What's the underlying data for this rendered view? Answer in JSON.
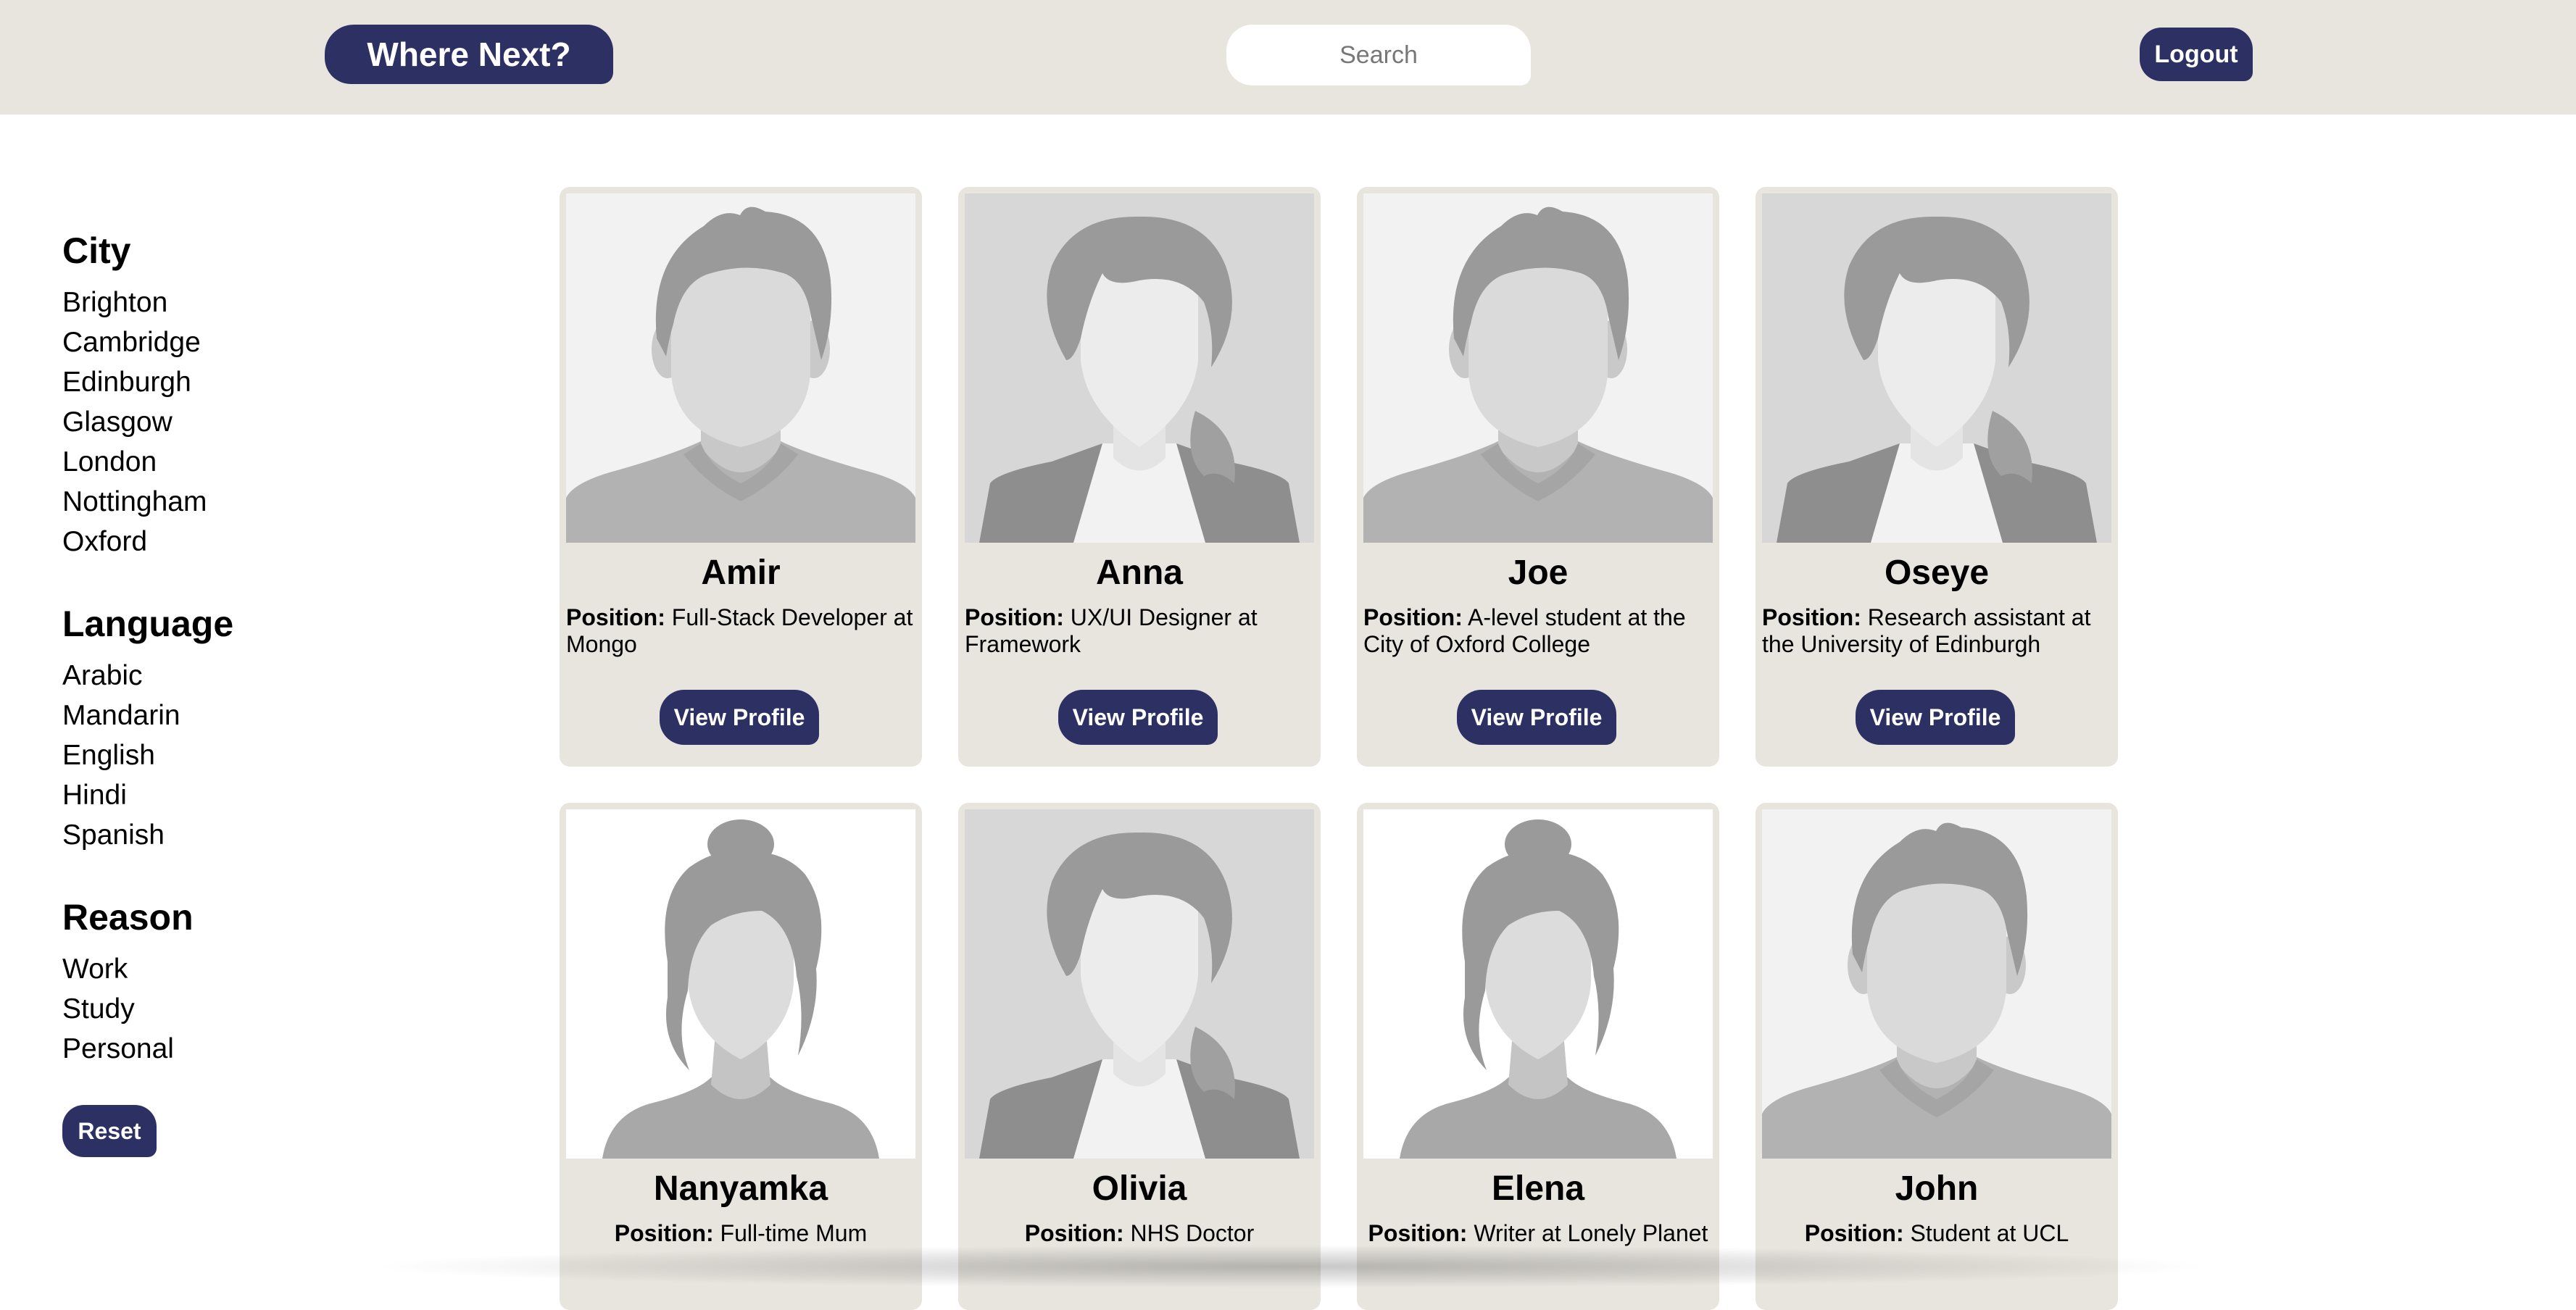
{
  "header": {
    "brand": "Where Next?",
    "search_placeholder": "Search",
    "logout": "Logout"
  },
  "filters": {
    "city": {
      "title": "City",
      "items": [
        "Brighton",
        "Cambridge",
        "Edinburgh",
        "Glasgow",
        "London",
        "Nottingham",
        "Oxford"
      ]
    },
    "language": {
      "title": "Language",
      "items": [
        "Arabic",
        "Mandarin",
        "English",
        "Hindi",
        "Spanish"
      ]
    },
    "reason": {
      "title": "Reason",
      "items": [
        "Work",
        "Study",
        "Personal"
      ]
    },
    "reset": "Reset"
  },
  "position_label": "Position:",
  "view_profile": "View Profile",
  "people": [
    {
      "name": "Amir",
      "position": "Full-Stack Developer at Mongo",
      "avatar": "male-avatar-icon",
      "bg": "#f2f2f2"
    },
    {
      "name": "Anna",
      "position": "UX/UI Designer at Framework",
      "avatar": "female-ponytail-avatar-icon",
      "bg": "#d7d7d7"
    },
    {
      "name": "Joe",
      "position": "A-level student at the City of Oxford College",
      "avatar": "male-avatar-icon",
      "bg": "#f2f2f2"
    },
    {
      "name": "Oseye",
      "position": "Research assistant at the University of Edinburgh",
      "avatar": "female-ponytail-avatar-icon",
      "bg": "#d7d7d7"
    },
    {
      "name": "Nanyamka",
      "position": "Full-time Mum",
      "avatar": "female-bun-avatar-icon",
      "bg": "#ffffff"
    },
    {
      "name": "Olivia",
      "position": "NHS Doctor",
      "avatar": "female-ponytail-avatar-icon",
      "bg": "#d7d7d7"
    },
    {
      "name": "Elena",
      "position": "Writer at Lonely Planet",
      "avatar": "female-bun-avatar-icon",
      "bg": "#ffffff"
    },
    {
      "name": "John",
      "position": "Student at UCL",
      "avatar": "male-avatar-icon",
      "bg": "#f2f2f2"
    }
  ]
}
